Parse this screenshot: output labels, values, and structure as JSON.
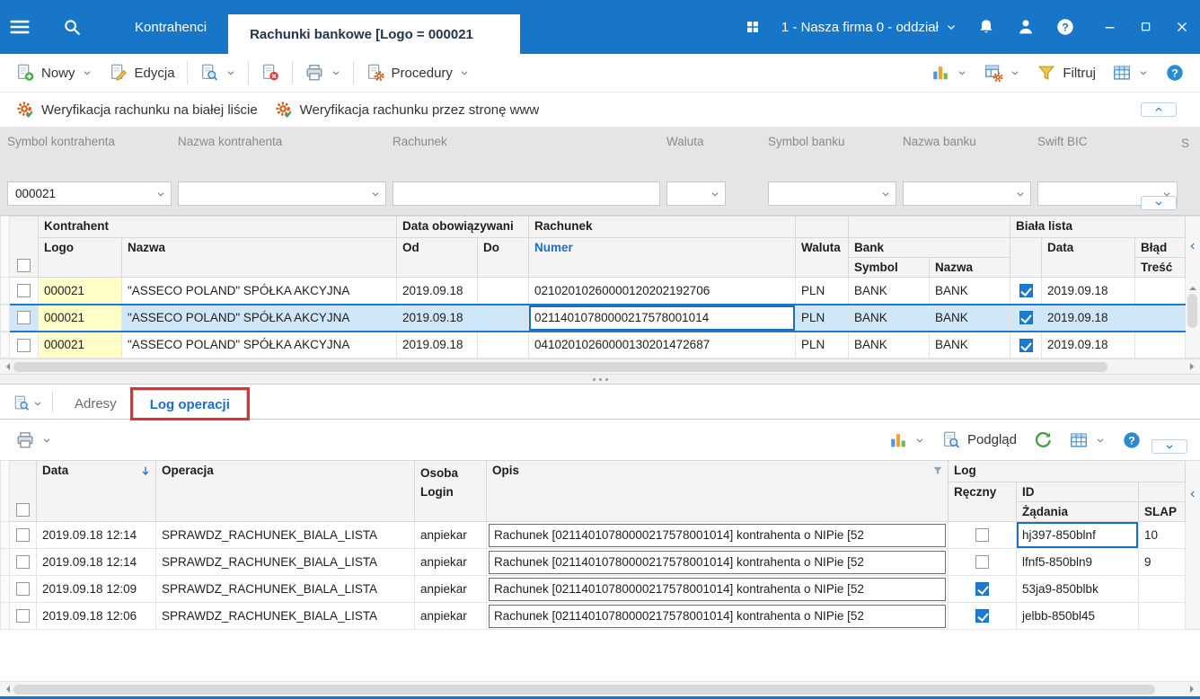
{
  "colors": {
    "brand_blue": "#1776c8",
    "accent": "#1a6fc4",
    "sel_bg": "#cfe7f8",
    "sel_border": "#1d7ad0",
    "ann_red": "#e0312f",
    "cell_yellow": "#ffffc8"
  },
  "window": {
    "tabs": [
      {
        "label": "Kontrahenci"
      },
      {
        "label": "Rachunki bankowe [Logo = 000021"
      }
    ],
    "company_selector": "1 - Nasza firma 0 - oddział"
  },
  "toolbar_main": {
    "new": "Nowy",
    "edit": "Edycja",
    "procedures": "Procedury",
    "filter": "Filtruj"
  },
  "verification_bar": {
    "verify_whitelist": "Weryfikacja rachunku na białej liście",
    "verify_www": "Weryfikacja rachunku przez stronę www"
  },
  "filter_panel": {
    "fields": [
      {
        "label": "Symbol kontrahenta",
        "value": "000021",
        "type": "select"
      },
      {
        "label": "Nazwa kontrahenta",
        "value": "",
        "type": "select"
      },
      {
        "label": "Rachunek",
        "value": "",
        "type": "text"
      },
      {
        "label": "Waluta",
        "value": "",
        "type": "select"
      },
      {
        "label": "Symbol banku",
        "value": "",
        "type": "select"
      },
      {
        "label": "Nazwa banku",
        "value": "",
        "type": "select"
      },
      {
        "label": "Swift BIC",
        "value": "",
        "type": "select"
      },
      {
        "label": "S",
        "value": "",
        "type": "select"
      }
    ]
  },
  "accounts_grid": {
    "groups": {
      "kontrahent": "Kontrahent",
      "data_obowiazywania": "Data obowiązywani",
      "rachunek": "Rachunek",
      "bank": "Bank",
      "biala_lista": "Biała lista"
    },
    "cols": {
      "logo": "Logo",
      "nazwa": "Nazwa",
      "od": "Od",
      "do": "Do",
      "numer": "Numer",
      "waluta": "Waluta",
      "bank_symbol": "Symbol",
      "bank_nazwa": "Nazwa",
      "data": "Data",
      "blad": "Błąd",
      "tresc": "Treść"
    },
    "rows": [
      {
        "logo": "000021",
        "nazwa": "\"ASSECO POLAND\" SPÓŁKA AKCYJNA",
        "od": "2019.09.18",
        "do": "",
        "numer": "02102010260000120202192706",
        "waluta": "PLN",
        "bank_symbol": "BANK",
        "bank_nazwa": "BANK",
        "biala_lista": true,
        "data": "2019.09.18",
        "blad": ""
      },
      {
        "logo": "000021",
        "nazwa": "\"ASSECO POLAND\" SPÓŁKA AKCYJNA",
        "od": "2019.09.18",
        "do": "",
        "numer": "02114010780000217578001014",
        "waluta": "PLN",
        "bank_symbol": "BANK",
        "bank_nazwa": "BANK",
        "biala_lista": true,
        "data": "2019.09.18",
        "blad": "",
        "selected": true
      },
      {
        "logo": "000021",
        "nazwa": "\"ASSECO POLAND\" SPÓŁKA AKCYJNA",
        "od": "2019.09.18",
        "do": "",
        "numer": "04102010260000130201472687",
        "waluta": "PLN",
        "bank_symbol": "BANK",
        "bank_nazwa": "BANK",
        "biala_lista": true,
        "data": "2019.09.18",
        "blad": ""
      }
    ]
  },
  "detail_panel": {
    "tabs": {
      "adresy": "Adresy",
      "log_operacji": "Log operacji"
    },
    "toolbar": {
      "preview": "Podgląd"
    }
  },
  "log_grid": {
    "cols": {
      "data": "Data",
      "operacja": "Operacja",
      "osoba": "Osoba",
      "login": "Login",
      "opis": "Opis",
      "log": "Log",
      "reczny": "Ręczny",
      "id": "ID",
      "zadania": "Żądania",
      "slap": "SLAP"
    },
    "rows": [
      {
        "data": "2019.09.18 12:14",
        "operacja": "SPRAWDZ_RACHUNEK_BIALA_LISTA",
        "login": "anpiekar",
        "opis": "Rachunek [02114010780000217578001014] kontrahenta o NIPie [52",
        "reczny": false,
        "id_zadania": "hj397-850blnf",
        "slap": "10"
      },
      {
        "data": "2019.09.18 12:14",
        "operacja": "SPRAWDZ_RACHUNEK_BIALA_LISTA",
        "login": "anpiekar",
        "opis": "Rachunek [02114010780000217578001014] kontrahenta o NIPie [52",
        "reczny": false,
        "id_zadania": "lfnf5-850bln9",
        "slap": "9"
      },
      {
        "data": "2019.09.18 12:09",
        "operacja": "SPRAWDZ_RACHUNEK_BIALA_LISTA",
        "login": "anpiekar",
        "opis": "Rachunek [02114010780000217578001014] kontrahenta o NIPie [52",
        "reczny": true,
        "id_zadania": "53ja9-850blbk",
        "slap": ""
      },
      {
        "data": "2019.09.18 12:06",
        "operacja": "SPRAWDZ_RACHUNEK_BIALA_LISTA",
        "login": "anpiekar",
        "opis": "Rachunek [02114010780000217578001014] kontrahenta o NIPie [52",
        "reczny": true,
        "id_zadania": "jelbb-850bl45",
        "slap": ""
      }
    ]
  }
}
